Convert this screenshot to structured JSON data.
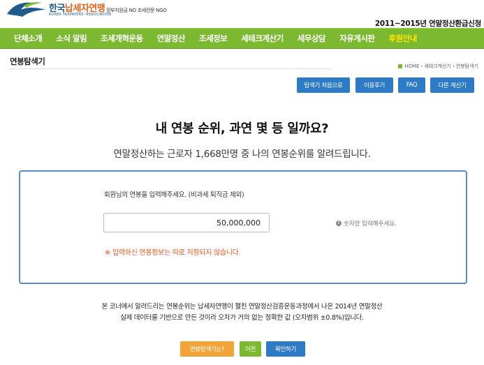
{
  "header": {
    "logo_icon": "bird-logo-icon",
    "org_name_part1": "한국",
    "org_name_part2": "납세자연맹",
    "org_name_en": "KOREA TAXPAYERS' ASSOCIATION",
    "slogan": "정부지원금 NO 조세전문 NGO",
    "campaign": "2011~2015년 연말정산환급신청"
  },
  "nav": {
    "items": [
      {
        "label": "단체소개"
      },
      {
        "label": "소식 알림"
      },
      {
        "label": "조세개혁운동"
      },
      {
        "label": "연말정산"
      },
      {
        "label": "조세정보"
      },
      {
        "label": "세테크계산기"
      },
      {
        "label": "세무상담"
      },
      {
        "label": "자유게시판"
      },
      {
        "label": "후원안내"
      }
    ],
    "highlight_color": "#ffe600",
    "bar_color": "#7cb830"
  },
  "page": {
    "title": "연봉탐색기",
    "breadcrumb": {
      "home_icon": "home-icon",
      "home": "HOME",
      "sep1": "›",
      "parent": "세테크계산기",
      "sep2": "›",
      "current": "연봉탐색기"
    }
  },
  "actions": {
    "restart": "탐색기 처음으로",
    "review": "이용후기",
    "faq": "FAQ",
    "other": "다른 계산기"
  },
  "headline": {
    "main": "내 연봉 순위, 과연 몇 등 일까요?",
    "sub": "연말정산하는 근로자 1,668만명 중 나의 연봉순위를 알려드립니다."
  },
  "form": {
    "label": "회원님의 연봉을 입력해주세요. (비과세 퇴직금 제외)",
    "salary_value": "50,000,000",
    "hint_icon": "info-icon",
    "hint": "숫자만 입력해주세요.",
    "warning": "※ 입력하신 연봉정보는 따로 저장되지 않습니다."
  },
  "notice": {
    "line1": "본 코너에서 알려드리는 연봉순위는 납세자연맹이 펼친 연말정산검증운동과정에서 나온 2014년 연말정산",
    "line2": "실제 데이터를 기반으로 만든 것이라 오차가 거의 없는 정확한 값 (오차범위 ±0.8%)입니다."
  },
  "bottom_buttons": {
    "what": "연봉탐색기는?",
    "prev": "이전",
    "confirm": "확인하기"
  },
  "colors": {
    "accent_blue": "#2d7ac6",
    "panel_border": "#5b8ac8",
    "warning": "#e8551e",
    "orange_button": "#f2a43a"
  }
}
